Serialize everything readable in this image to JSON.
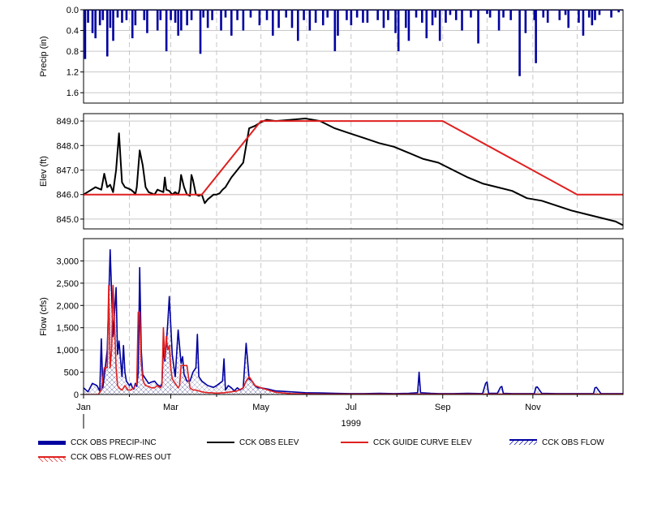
{
  "colors": {
    "precip": "#0000a0",
    "obs_elev": "#000000",
    "guide_curve": "#e02020",
    "obs_flow": "#0000a0",
    "flow_res_out": "#e02020",
    "grid": "#c8c8c8",
    "background": "#ffffff"
  },
  "x_axis": {
    "year_label": "1999",
    "month_ticks": [
      {
        "label": "Jan",
        "day": 0
      },
      {
        "label": "Mar",
        "day": 59
      },
      {
        "label": "May",
        "day": 120
      },
      {
        "label": "Jul",
        "day": 181
      },
      {
        "label": "Sep",
        "day": 243
      },
      {
        "label": "Nov",
        "day": 304
      }
    ],
    "minor_ticks": [
      31,
      90,
      151,
      212,
      273,
      334
    ],
    "range_days": [
      0,
      365
    ]
  },
  "legend": [
    {
      "name": "CCK OBS PRECIP-INC",
      "style": "thick-bar"
    },
    {
      "name": "CCK OBS ELEV",
      "style": "line-black"
    },
    {
      "name": "CCK GUIDE CURVE ELEV",
      "style": "line-red"
    },
    {
      "name": "CCK OBS FLOW",
      "style": "hatch-blue"
    },
    {
      "name": "CCK OBS FLOW-RES OUT",
      "style": "hatch-red"
    }
  ],
  "chart_data": [
    {
      "type": "bar",
      "ylabel": "Precip (in)",
      "ylim": [
        0,
        1.8
      ],
      "y_inverted": true,
      "yticks": [
        "0.0",
        "0.4",
        "0.8",
        "1.2",
        "1.6"
      ],
      "ytick_values": [
        0,
        0.4,
        0.8,
        1.2,
        1.6
      ],
      "series": [
        {
          "name": "CCK OBS PRECIP-INC",
          "x_day": [
            1,
            3,
            6,
            8,
            11,
            13,
            16,
            18,
            20,
            23,
            26,
            29,
            33,
            35,
            41,
            43,
            50,
            52,
            56,
            59,
            62,
            64,
            66,
            70,
            73,
            79,
            81,
            84,
            87,
            93,
            96,
            100,
            104,
            108,
            113,
            119,
            124,
            128,
            132,
            137,
            141,
            145,
            149,
            153,
            157,
            162,
            165,
            170,
            172,
            178,
            181,
            185,
            189,
            192,
            199,
            203,
            206,
            211,
            213,
            218,
            220,
            225,
            229,
            232,
            236,
            238,
            241,
            245,
            248,
            252,
            256,
            262,
            267,
            273,
            275,
            281,
            284,
            289,
            295,
            299,
            305,
            306,
            311,
            314,
            322,
            326,
            328,
            335,
            338,
            342,
            344,
            346,
            349,
            357,
            362
          ],
          "values": [
            0.95,
            0.25,
            0.45,
            0.55,
            0.3,
            0.2,
            0.9,
            0.35,
            0.6,
            0.15,
            0.25,
            0.2,
            0.55,
            0.3,
            0.2,
            0.45,
            0.4,
            0.2,
            0.8,
            0.2,
            0.25,
            0.5,
            0.4,
            0.3,
            0.2,
            0.85,
            0.15,
            0.35,
            0.2,
            0.4,
            0.15,
            0.5,
            0.2,
            0.4,
            0.15,
            0.3,
            0.2,
            0.5,
            0.35,
            0.15,
            0.35,
            0.6,
            0.2,
            0.4,
            0.25,
            0.3,
            0.15,
            0.8,
            0.5,
            0.2,
            0.3,
            0.15,
            0.25,
            0.25,
            0.2,
            0.35,
            0.2,
            0.45,
            0.8,
            0.35,
            0.6,
            0.15,
            0.25,
            0.55,
            0.3,
            0.15,
            0.6,
            0.25,
            0.1,
            0.2,
            0.4,
            0.15,
            0.65,
            0.08,
            0.15,
            0.4,
            0.15,
            0.2,
            1.28,
            0.45,
            0.2,
            1.03,
            0.15,
            0.25,
            0.2,
            0.1,
            0.35,
            0.25,
            0.5,
            0.15,
            0.3,
            0.2,
            0.1,
            0.15,
            0.05
          ]
        }
      ]
    },
    {
      "type": "line",
      "ylabel": "Elev (ft)",
      "ylim": [
        844.6,
        849.3
      ],
      "yticks": [
        "845.0",
        "846.0",
        "847.0",
        "848.0",
        "849.0"
      ],
      "ytick_values": [
        845,
        846,
        847,
        848,
        849
      ],
      "series": [
        {
          "name": "CCK OBS ELEV",
          "x_day": [
            0,
            4,
            8,
            12,
            14,
            16,
            18,
            20,
            22,
            24,
            25,
            26,
            28,
            30,
            32,
            34,
            35,
            36,
            38,
            40,
            42,
            44,
            46,
            48,
            50,
            52,
            54,
            55,
            56,
            58,
            60,
            62,
            64,
            65,
            66,
            68,
            70,
            72,
            73,
            74,
            76,
            78,
            80,
            82,
            84,
            86,
            88,
            90,
            92,
            94,
            96,
            98,
            100,
            104,
            108,
            112,
            116,
            120,
            124,
            130,
            140,
            150,
            160,
            170,
            180,
            190,
            200,
            210,
            220,
            230,
            240,
            250,
            260,
            270,
            280,
            290,
            300,
            310,
            320,
            330,
            340,
            350,
            360,
            365
          ],
          "values": [
            846.0,
            846.15,
            846.3,
            846.2,
            846.85,
            846.3,
            846.4,
            846.1,
            847.0,
            848.5,
            847.5,
            846.5,
            846.3,
            846.25,
            846.2,
            846.1,
            846.0,
            846.3,
            847.8,
            847.2,
            846.3,
            846.1,
            846.05,
            846.0,
            846.2,
            846.15,
            846.1,
            846.7,
            846.2,
            846.15,
            846.0,
            846.1,
            846.0,
            846.2,
            846.8,
            846.3,
            846.0,
            845.95,
            846.8,
            846.6,
            846.0,
            845.95,
            846.0,
            845.65,
            845.8,
            845.9,
            846.0,
            846.0,
            846.05,
            846.2,
            846.3,
            846.5,
            846.7,
            847.0,
            847.3,
            848.7,
            848.8,
            848.95,
            849.05,
            849.0,
            849.05,
            849.1,
            849.0,
            848.7,
            848.5,
            848.3,
            848.1,
            847.95,
            847.7,
            847.45,
            847.3,
            847.0,
            846.7,
            846.45,
            846.3,
            846.15,
            845.85,
            845.75,
            845.55,
            845.35,
            845.2,
            845.05,
            844.9,
            844.75
          ]
        },
        {
          "name": "CCK GUIDE CURVE ELEV",
          "x_day": [
            0,
            80,
            120,
            243,
            334,
            365
          ],
          "values": [
            846.0,
            846.0,
            849.0,
            849.0,
            846.0,
            846.0
          ]
        }
      ]
    },
    {
      "type": "line",
      "ylabel": "Flow (cfs)",
      "ylim": [
        0,
        3500
      ],
      "yticks": [
        "0",
        "500",
        "1,000",
        "1,500",
        "2,000",
        "2,500",
        "3,000"
      ],
      "ytick_values": [
        0,
        500,
        1000,
        1500,
        2000,
        2500,
        3000
      ],
      "series": [
        {
          "name": "CCK OBS FLOW",
          "x_day": [
            0,
            3,
            6,
            9,
            11,
            12,
            13,
            14,
            16,
            18,
            20,
            22,
            23,
            24,
            25,
            26,
            27,
            28,
            29,
            30,
            31,
            32,
            33,
            34,
            35,
            36,
            37,
            38,
            39,
            40,
            42,
            44,
            46,
            48,
            50,
            52,
            53,
            54,
            55,
            56,
            57,
            58,
            60,
            62,
            64,
            66,
            67,
            68,
            70,
            72,
            74,
            76,
            77,
            78,
            80,
            82,
            84,
            86,
            88,
            90,
            92,
            94,
            95,
            96,
            98,
            100,
            102,
            104,
            106,
            108,
            110,
            112,
            114,
            116,
            118,
            120,
            125,
            130,
            140,
            150,
            160,
            170,
            180,
            190,
            200,
            210,
            220,
            226,
            227,
            228,
            235,
            240,
            250,
            260,
            270,
            272,
            273,
            274,
            280,
            282,
            283,
            284,
            290,
            300,
            305,
            306,
            307,
            310,
            320,
            340,
            345,
            346,
            347,
            350,
            360,
            365
          ],
          "values": [
            150,
            60,
            250,
            200,
            80,
            1250,
            150,
            400,
            1000,
            3250,
            1300,
            2400,
            900,
            1200,
            800,
            400,
            1100,
            500,
            300,
            250,
            200,
            250,
            160,
            120,
            250,
            180,
            500,
            2850,
            1000,
            450,
            350,
            250,
            280,
            300,
            220,
            180,
            250,
            1050,
            750,
            1150,
            1600,
            2200,
            900,
            400,
            1450,
            700,
            850,
            450,
            300,
            300,
            500,
            600,
            1350,
            400,
            300,
            250,
            200,
            180,
            160,
            200,
            250,
            300,
            800,
            100,
            200,
            150,
            80,
            150,
            100,
            150,
            1150,
            350,
            300,
            200,
            150,
            150,
            120,
            80,
            60,
            40,
            35,
            25,
            20,
            20,
            25,
            20,
            25,
            40,
            500,
            40,
            25,
            20,
            20,
            25,
            20,
            250,
            280,
            30,
            25,
            160,
            180,
            25,
            20,
            20,
            20,
            160,
            170,
            25,
            20,
            20,
            20,
            150,
            160,
            20,
            20,
            20
          ]
        },
        {
          "name": "CCK OBS FLOW-RES OUT",
          "x_day": [
            0,
            10,
            12,
            14,
            16,
            17,
            18,
            19,
            20,
            21,
            22,
            23,
            24,
            25,
            26,
            27,
            28,
            30,
            32,
            34,
            36,
            37,
            38,
            39,
            40,
            41,
            42,
            44,
            46,
            48,
            50,
            52,
            53,
            54,
            55,
            56,
            57,
            58,
            59,
            60,
            62,
            64,
            65,
            66,
            68,
            70,
            72,
            74,
            76,
            78,
            80,
            82,
            84,
            86,
            90,
            95,
            100,
            104,
            108,
            110,
            112,
            116,
            120,
            130,
            140,
            160,
            180,
            200,
            220,
            240,
            260,
            280,
            300,
            320,
            340,
            365
          ],
          "values": [
            0,
            0,
            100,
            600,
            600,
            2450,
            600,
            1000,
            2450,
            1500,
            600,
            200,
            150,
            120,
            100,
            150,
            200,
            100,
            100,
            150,
            250,
            1850,
            1850,
            700,
            350,
            250,
            200,
            180,
            150,
            150,
            200,
            150,
            200,
            1500,
            800,
            1300,
            1000,
            1100,
            600,
            350,
            250,
            150,
            200,
            650,
            650,
            650,
            150,
            100,
            100,
            80,
            60,
            50,
            40,
            40,
            30,
            40,
            60,
            80,
            150,
            300,
            400,
            200,
            150,
            50,
            20,
            10,
            10,
            10,
            10,
            10,
            10,
            10,
            10,
            10,
            10,
            10
          ]
        }
      ]
    }
  ]
}
